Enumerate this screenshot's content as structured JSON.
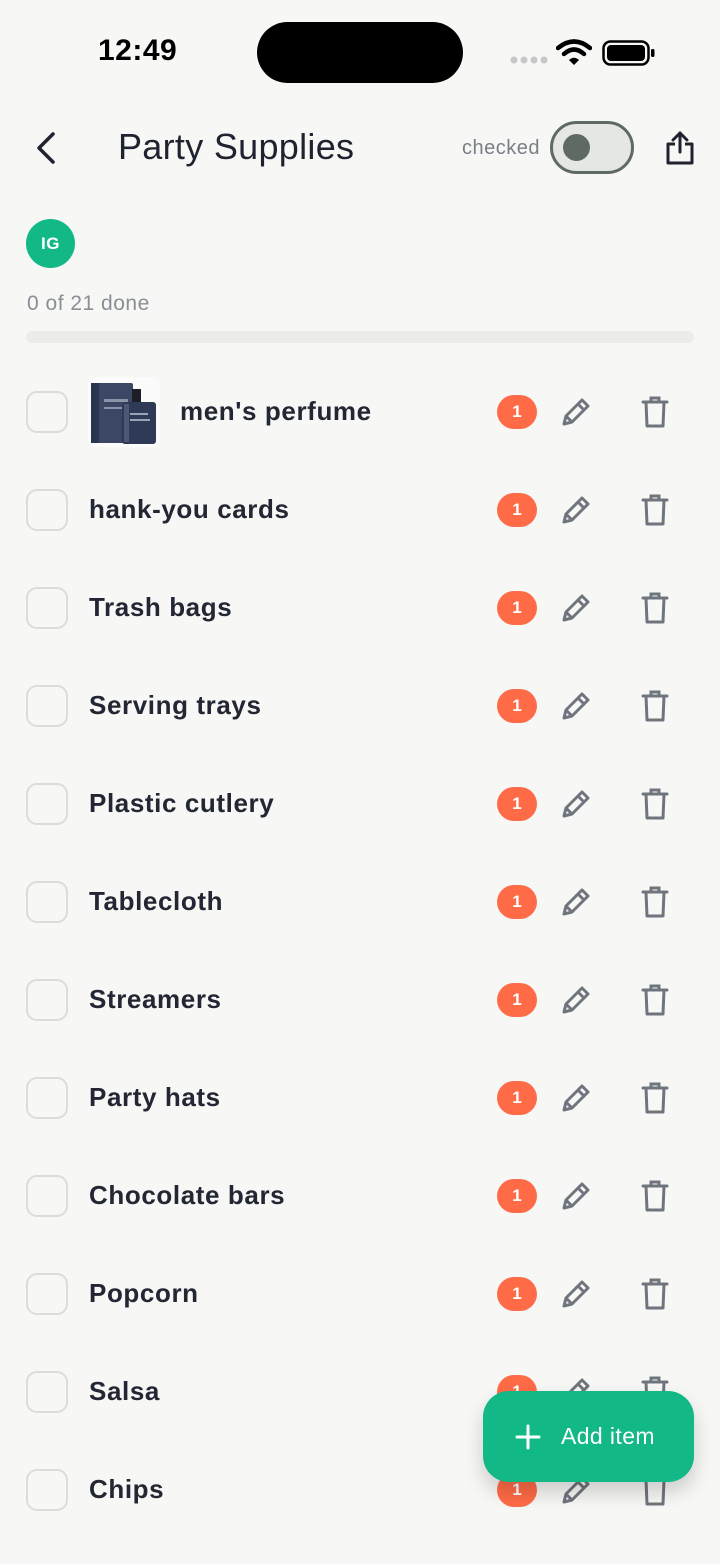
{
  "status_bar": {
    "time": "12:49"
  },
  "header": {
    "title": "Party Supplies",
    "toggle_label": "checked",
    "toggle_on": false
  },
  "avatar": {
    "initials": "IG",
    "color": "#12b886"
  },
  "progress": {
    "text": "0 of 21 done",
    "done": 0,
    "total": 21
  },
  "items": [
    {
      "name": "men's perfume",
      "qty": "1",
      "has_image": true
    },
    {
      "name": "hank-you cards",
      "qty": "1",
      "has_image": false
    },
    {
      "name": "Trash bags",
      "qty": "1",
      "has_image": false
    },
    {
      "name": "Serving trays",
      "qty": "1",
      "has_image": false
    },
    {
      "name": "Plastic cutlery",
      "qty": "1",
      "has_image": false
    },
    {
      "name": "Tablecloth",
      "qty": "1",
      "has_image": false
    },
    {
      "name": "Streamers",
      "qty": "1",
      "has_image": false
    },
    {
      "name": "Party hats",
      "qty": "1",
      "has_image": false
    },
    {
      "name": "Chocolate bars",
      "qty": "1",
      "has_image": false
    },
    {
      "name": "Popcorn",
      "qty": "1",
      "has_image": false
    },
    {
      "name": "Salsa",
      "qty": "1",
      "has_image": false
    },
    {
      "name": "Chips",
      "qty": "1",
      "has_image": false
    }
  ],
  "fab": {
    "label": "Add item",
    "icon": "plus-icon"
  },
  "colors": {
    "accent": "#12b886",
    "badge": "#ff6b47",
    "icon_gray": "#6f757d"
  },
  "icons": {
    "edit": "pencil-icon",
    "delete": "trash-icon",
    "back": "chevron-left-icon",
    "share": "share-icon"
  }
}
